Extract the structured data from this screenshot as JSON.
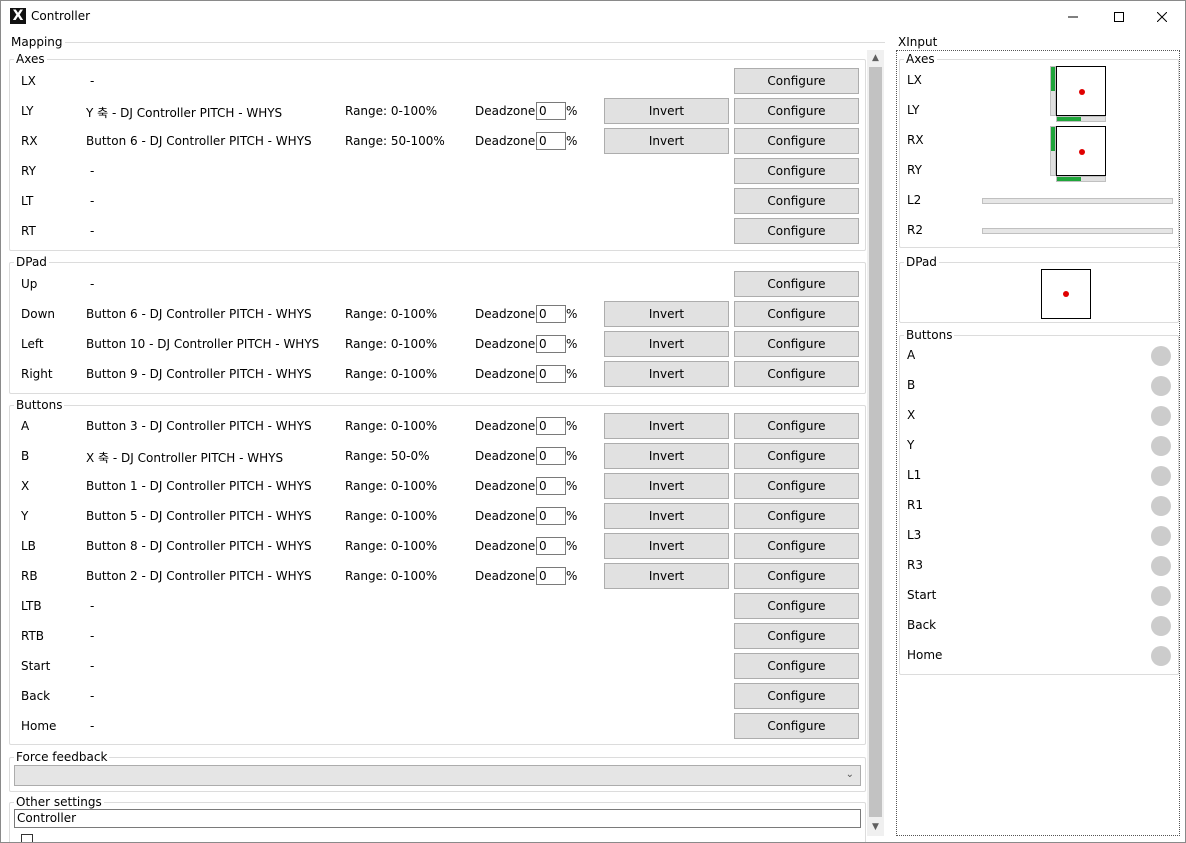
{
  "window": {
    "title": "Controller",
    "icon_text": "X"
  },
  "mapping": {
    "title": "Mapping",
    "axes": {
      "title": "Axes",
      "rows": [
        {
          "name": "LX",
          "source": "-",
          "range": "",
          "deadzone": "",
          "configure": "Configure"
        },
        {
          "name": "LY",
          "source": "Y 축 - DJ Controller PITCH - WHYS",
          "range": "Range: 0-100%",
          "deadzone_label": "Deadzone:",
          "deadzone": "0",
          "percent": "%",
          "invert": "Invert",
          "configure": "Configure"
        },
        {
          "name": "RX",
          "source": "Button 6 - DJ Controller PITCH - WHYS",
          "range": "Range: 50-100%",
          "deadzone_label": "Deadzone:",
          "deadzone": "0",
          "percent": "%",
          "invert": "Invert",
          "configure": "Configure"
        },
        {
          "name": "RY",
          "source": "-",
          "configure": "Configure"
        },
        {
          "name": "LT",
          "source": "-",
          "configure": "Configure"
        },
        {
          "name": "RT",
          "source": "-",
          "configure": "Configure"
        }
      ]
    },
    "dpad": {
      "title": "DPad",
      "rows": [
        {
          "name": "Up",
          "source": "-",
          "configure": "Configure"
        },
        {
          "name": "Down",
          "source": "Button 6 - DJ Controller PITCH - WHYS",
          "range": "Range: 0-100%",
          "deadzone_label": "Deadzone:",
          "deadzone": "0",
          "percent": "%",
          "invert": "Invert",
          "configure": "Configure"
        },
        {
          "name": "Left",
          "source": "Button 10 - DJ Controller PITCH - WHYS",
          "range": "Range: 0-100%",
          "deadzone_label": "Deadzone:",
          "deadzone": "0",
          "percent": "%",
          "invert": "Invert",
          "configure": "Configure"
        },
        {
          "name": "Right",
          "source": "Button 9 - DJ Controller PITCH - WHYS",
          "range": "Range: 0-100%",
          "deadzone_label": "Deadzone:",
          "deadzone": "0",
          "percent": "%",
          "invert": "Invert",
          "configure": "Configure"
        }
      ]
    },
    "buttons": {
      "title": "Buttons",
      "rows": [
        {
          "name": "A",
          "source": "Button 3 - DJ Controller PITCH - WHYS",
          "range": "Range: 0-100%",
          "deadzone_label": "Deadzone:",
          "deadzone": "0",
          "percent": "%",
          "invert": "Invert",
          "configure": "Configure"
        },
        {
          "name": "B",
          "source": "X 축 - DJ Controller PITCH - WHYS",
          "range": "Range: 50-0%",
          "deadzone_label": "Deadzone:",
          "deadzone": "0",
          "percent": "%",
          "invert": "Invert",
          "configure": "Configure"
        },
        {
          "name": "X",
          "source": "Button 1 - DJ Controller PITCH - WHYS",
          "range": "Range: 0-100%",
          "deadzone_label": "Deadzone:",
          "deadzone": "0",
          "percent": "%",
          "invert": "Invert",
          "configure": "Configure"
        },
        {
          "name": "Y",
          "source": "Button 5 - DJ Controller PITCH - WHYS",
          "range": "Range: 0-100%",
          "deadzone_label": "Deadzone:",
          "deadzone": "0",
          "percent": "%",
          "invert": "Invert",
          "configure": "Configure"
        },
        {
          "name": "LB",
          "source": "Button 8 - DJ Controller PITCH - WHYS",
          "range": "Range: 0-100%",
          "deadzone_label": "Deadzone:",
          "deadzone": "0",
          "percent": "%",
          "invert": "Invert",
          "configure": "Configure"
        },
        {
          "name": "RB",
          "source": "Button 2 - DJ Controller PITCH - WHYS",
          "range": "Range: 0-100%",
          "deadzone_label": "Deadzone:",
          "deadzone": "0",
          "percent": "%",
          "invert": "Invert",
          "configure": "Configure"
        },
        {
          "name": "LTB",
          "source": "-",
          "configure": "Configure"
        },
        {
          "name": "RTB",
          "source": "-",
          "configure": "Configure"
        },
        {
          "name": "Start",
          "source": "-",
          "configure": "Configure"
        },
        {
          "name": "Back",
          "source": "-",
          "configure": "Configure"
        },
        {
          "name": "Home",
          "source": "-",
          "configure": "Configure"
        }
      ]
    },
    "force_feedback": {
      "title": "Force feedback",
      "selected": ""
    },
    "other_settings": {
      "title": "Other settings",
      "name_value": "Controller"
    }
  },
  "xinput": {
    "title": "XInput",
    "axes": {
      "title": "Axes",
      "labels": [
        "LX",
        "LY",
        "RX",
        "RY",
        "L2",
        "R2"
      ],
      "left_stick": {
        "vertical_level": 0.5,
        "horizontal_level": 0.5
      },
      "right_stick": {
        "vertical_level": 0.5,
        "horizontal_level": 0.5
      },
      "l2_level": 0,
      "r2_level": 0
    },
    "dpad": {
      "title": "DPad"
    },
    "buttons": {
      "title": "Buttons",
      "labels": [
        "A",
        "B",
        "X",
        "Y",
        "L1",
        "R1",
        "L3",
        "R3",
        "Start",
        "Back",
        "Home"
      ]
    }
  },
  "colors": {
    "active_fill": "#1fa53a",
    "stick_dot": "#e00000",
    "button_off": "#cccccc"
  }
}
